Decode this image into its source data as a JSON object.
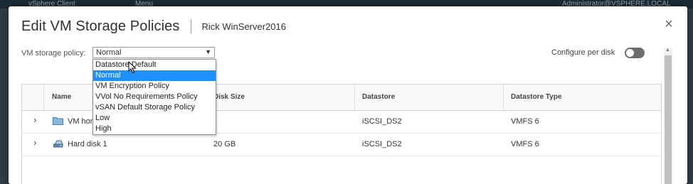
{
  "background": {
    "app_title": "vSphere Client",
    "menu_label": "Menu",
    "user_label": "Administrator@VSPHERE.LOCAL"
  },
  "dialog": {
    "title": "Edit VM Storage Policies",
    "subtitle": "Rick WinServer2016",
    "close_symbol": "×"
  },
  "policy": {
    "label": "VM storage policy:",
    "selected": "Normal",
    "options": [
      "Datastore Default",
      "Normal",
      "VM Encryption Policy",
      "VVol No Requirements Policy",
      "vSAN Default Storage Policy",
      "Low",
      "High"
    ]
  },
  "configure_per_disk": {
    "label": "Configure per disk",
    "enabled": false
  },
  "table": {
    "headers": [
      "Name",
      "Disk Size",
      "Datastore",
      "Datastore Type"
    ],
    "rows": [
      {
        "name": "VM home",
        "disk_size": "",
        "datastore": "iSCSI_DS2",
        "datastore_type": "VMFS 6",
        "icon": "folder-icon"
      },
      {
        "name": "Hard disk 1",
        "disk_size": "20 GB",
        "datastore": "iSCSI_DS2",
        "datastore_type": "VMFS 6",
        "icon": "hard-disk-icon"
      }
    ]
  },
  "colors": {
    "highlight": "#1e90ff",
    "toggle_off": "#6d6d6d",
    "folder": "#8ab9e0"
  }
}
